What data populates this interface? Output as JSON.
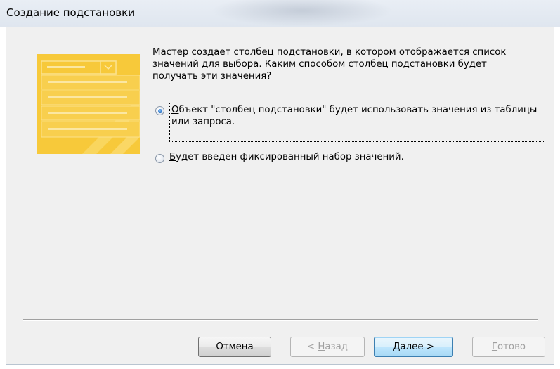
{
  "window": {
    "title": "Создание подстановки"
  },
  "intro_text": "Мастер создает столбец подстановки, в котором отображается список\nзначений для выбора.  Каким способом столбец подстановки будет\nполучать эти значения?",
  "options": [
    {
      "hotkey": "О",
      "label_rest": "бъект \"столбец подстановки\" будет использовать значения из таблицы или запроса.",
      "selected": true
    },
    {
      "hotkey": "Б",
      "label_rest": "удет введен фиксированный набор значений.",
      "selected": false
    }
  ],
  "buttons": {
    "cancel": "Отмена",
    "back_prefix": "< ",
    "back_hotkey": "Н",
    "back_rest": "азад",
    "next_hotkey": "Д",
    "next_rest": "алее >",
    "finish_hotkey": "Г",
    "finish_rest": "отово"
  },
  "colors": {
    "illustration": "#f7c93a",
    "dialog_bg": "#f0f0f0",
    "radio_selected": "#2a75c9"
  }
}
